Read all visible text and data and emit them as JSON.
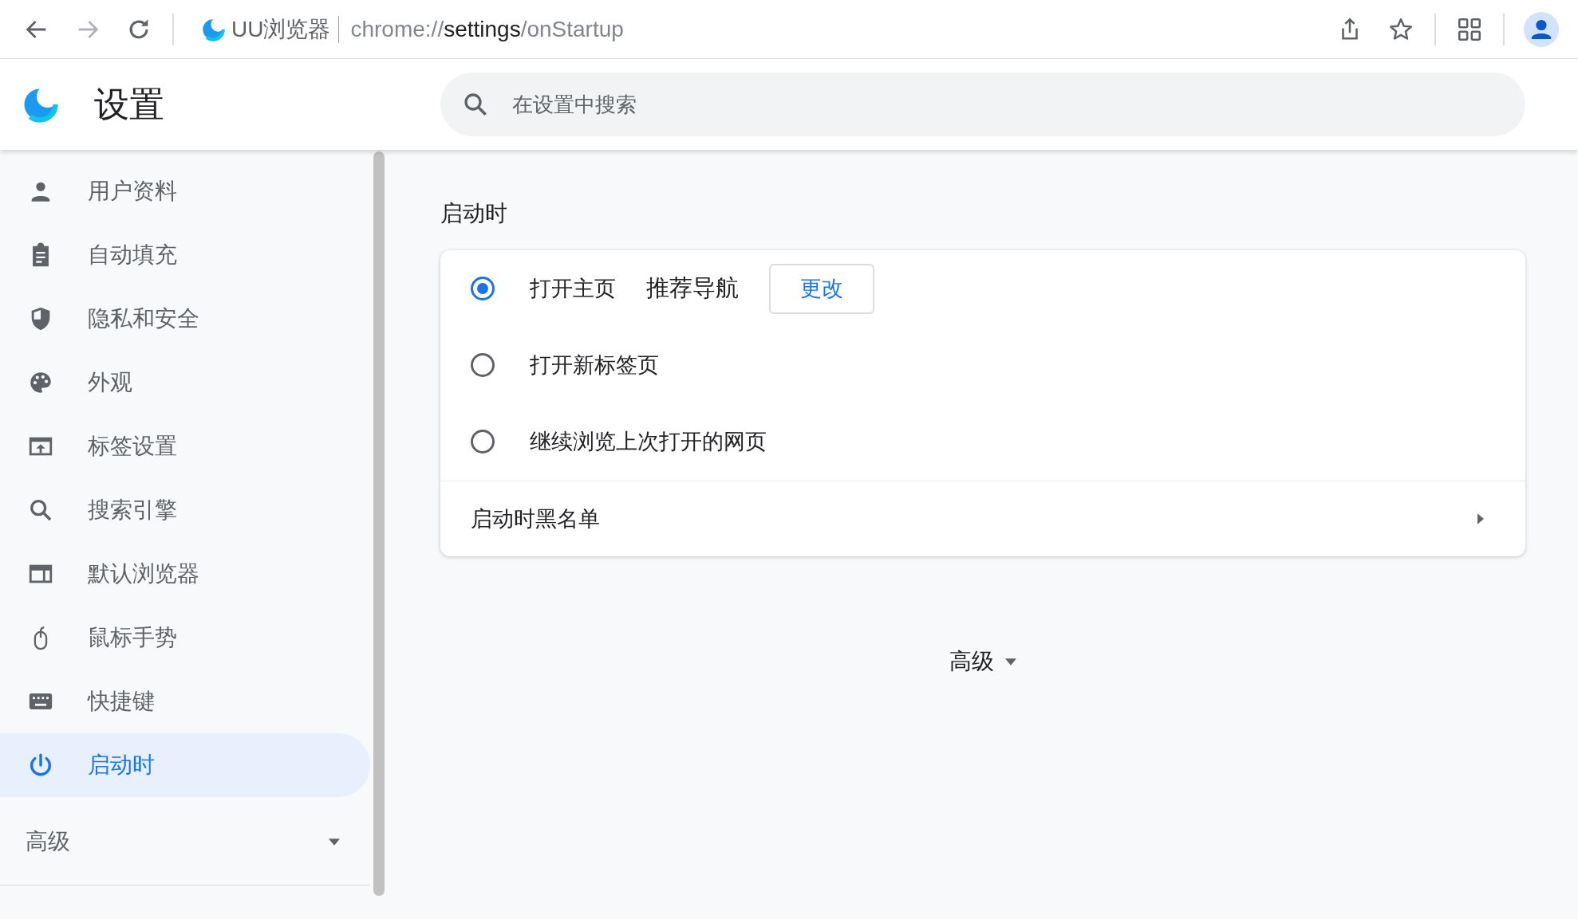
{
  "toolbar": {
    "site_name": "UU浏览器",
    "url_scheme": "chrome://",
    "url_host": "settings",
    "url_path": "/onStartup"
  },
  "header": {
    "title": "设置",
    "search": {
      "placeholder": "在设置中搜索"
    }
  },
  "sidebar": {
    "items": [
      {
        "label": "用户资料",
        "kind": "person",
        "selected": false
      },
      {
        "label": "自动填充",
        "kind": "clipboard",
        "selected": false
      },
      {
        "label": "隐私和安全",
        "kind": "shield",
        "selected": false
      },
      {
        "label": "外观",
        "kind": "palette",
        "selected": false
      },
      {
        "label": "标签设置",
        "kind": "tab",
        "selected": false
      },
      {
        "label": "搜索引擎",
        "kind": "search",
        "selected": false
      },
      {
        "label": "默认浏览器",
        "kind": "browser",
        "selected": false
      },
      {
        "label": "鼠标手势",
        "kind": "mouse",
        "selected": false
      },
      {
        "label": "快捷键",
        "kind": "keyboard",
        "selected": false
      },
      {
        "label": "启动时",
        "kind": "power",
        "selected": true
      }
    ],
    "advanced": {
      "label": "高级",
      "expanded": false
    }
  },
  "section": {
    "title": "启动时",
    "options": [
      {
        "label": "打开主页",
        "selected": true,
        "detail": "推荐导航",
        "button": "更改"
      },
      {
        "label": "打开新标签页",
        "selected": false
      },
      {
        "label": "继续浏览上次打开的网页",
        "selected": false
      }
    ],
    "link_row": {
      "label": "启动时黑名单"
    }
  },
  "advanced_toggle": {
    "label": "高级",
    "expanded": false
  }
}
